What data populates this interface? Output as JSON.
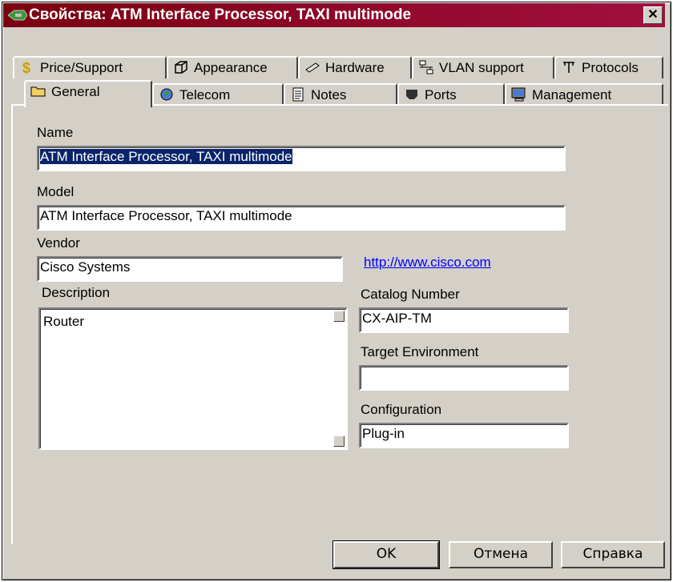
{
  "window": {
    "title": "Свойства: ATM Interface Processor, TAXI multimode",
    "close_label": "✕"
  },
  "tabs_back": [
    {
      "label": "Price/Support",
      "icon": "dollar-icon"
    },
    {
      "label": "Appearance",
      "icon": "cube-icon"
    },
    {
      "label": "Hardware",
      "icon": "chip-icon"
    },
    {
      "label": "VLAN support",
      "icon": "network-icon"
    },
    {
      "label": "Protocols",
      "icon": "protocol-icon"
    }
  ],
  "tabs_front": [
    {
      "label": "General",
      "icon": "folder-icon",
      "active": true
    },
    {
      "label": "Telecom",
      "icon": "globe-icon"
    },
    {
      "label": "Notes",
      "icon": "notes-icon"
    },
    {
      "label": "Ports",
      "icon": "port-icon"
    },
    {
      "label": "Management",
      "icon": "monitor-icon"
    }
  ],
  "form": {
    "name_label": "Name",
    "name_value": "ATM Interface Processor, TAXI multimode",
    "model_label": "Model",
    "model_value": "ATM Interface Processor, TAXI multimode",
    "vendor_label": "Vendor",
    "vendor_value": "Cisco Systems",
    "vendor_link": "http://www.cisco.com",
    "description_label": "Description",
    "description_value": "Router",
    "catalog_label": "Catalog Number",
    "catalog_value": "CX-AIP-TM",
    "target_label": "Target Environment",
    "target_value": "",
    "config_label": "Configuration",
    "config_value": "Plug-in"
  },
  "buttons": {
    "ok": "OK",
    "cancel": "Отмена",
    "help": "Справка"
  }
}
